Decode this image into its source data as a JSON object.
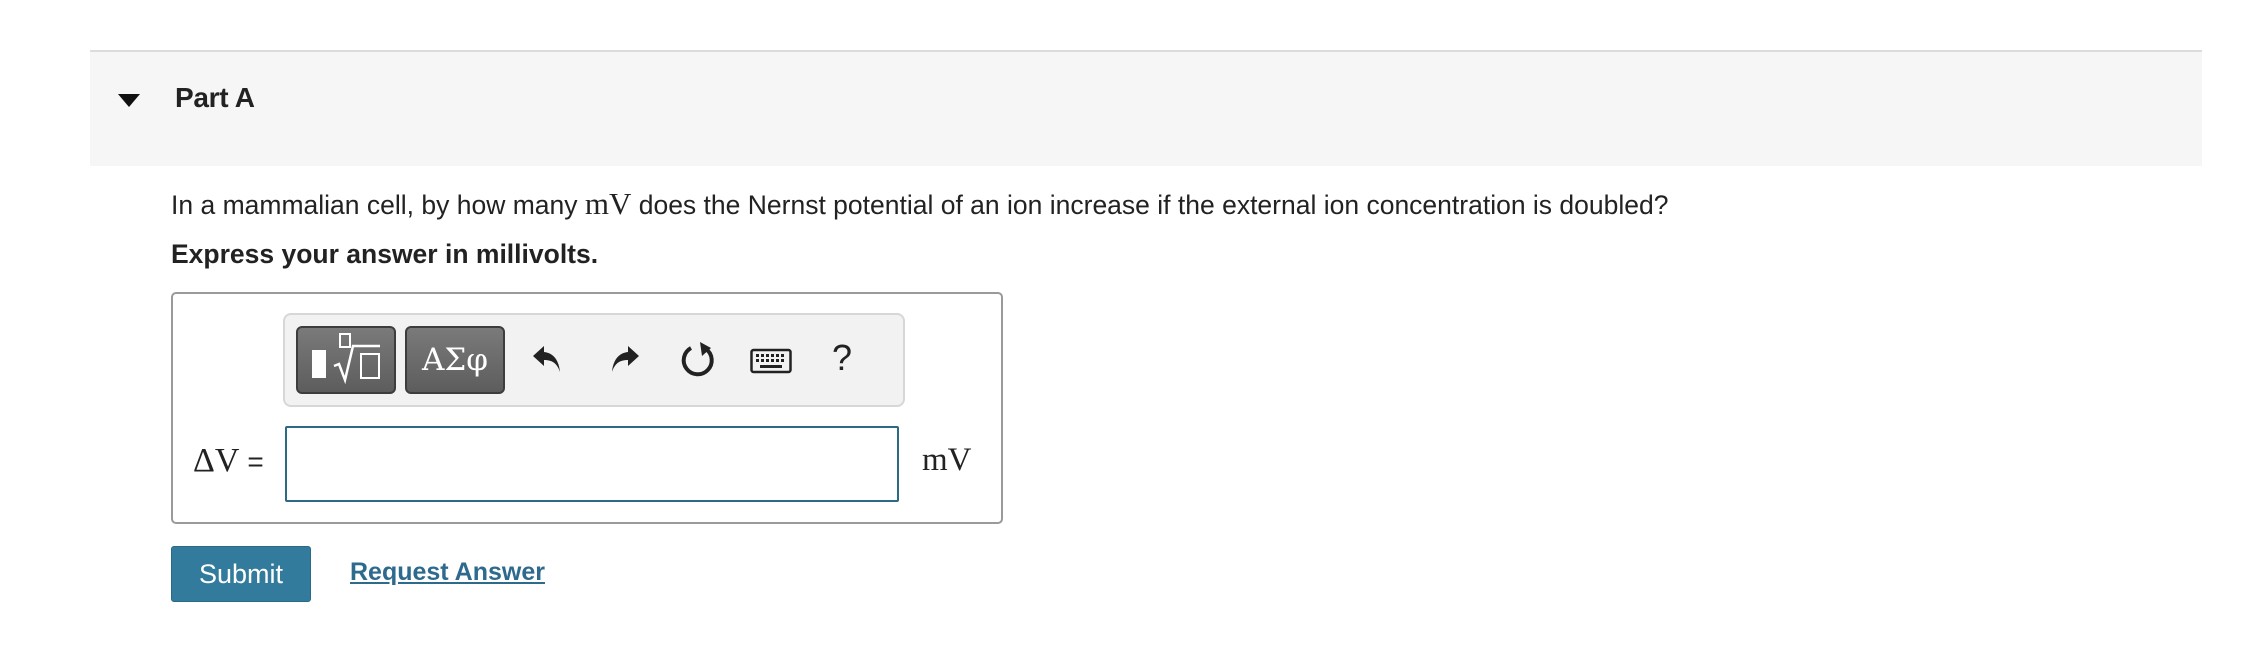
{
  "part": {
    "title": "Part A"
  },
  "question": {
    "text_before": "In a mammalian cell, by how many ",
    "unit_math": "mV",
    "text_after": " does the Nernst potential of an ion increase if the external ion concentration is doubled?"
  },
  "instruction": "Express your answer in millivolts.",
  "toolbar": {
    "symbols_label": "ΑΣφ",
    "help_label": "?",
    "icons": [
      "templates-icon",
      "undo-icon",
      "redo-icon",
      "reset-icon",
      "keyboard-icon"
    ]
  },
  "answer": {
    "variable_label": "ΔV",
    "equals": "=",
    "value": "",
    "unit": "mV"
  },
  "actions": {
    "submit_label": "Submit",
    "request_answer_label": "Request Answer"
  },
  "colors": {
    "header_background": "#f6f6f6",
    "submit_background": "#327b9c",
    "link": "#2d6a8e",
    "input_border": "#2d6a85"
  }
}
